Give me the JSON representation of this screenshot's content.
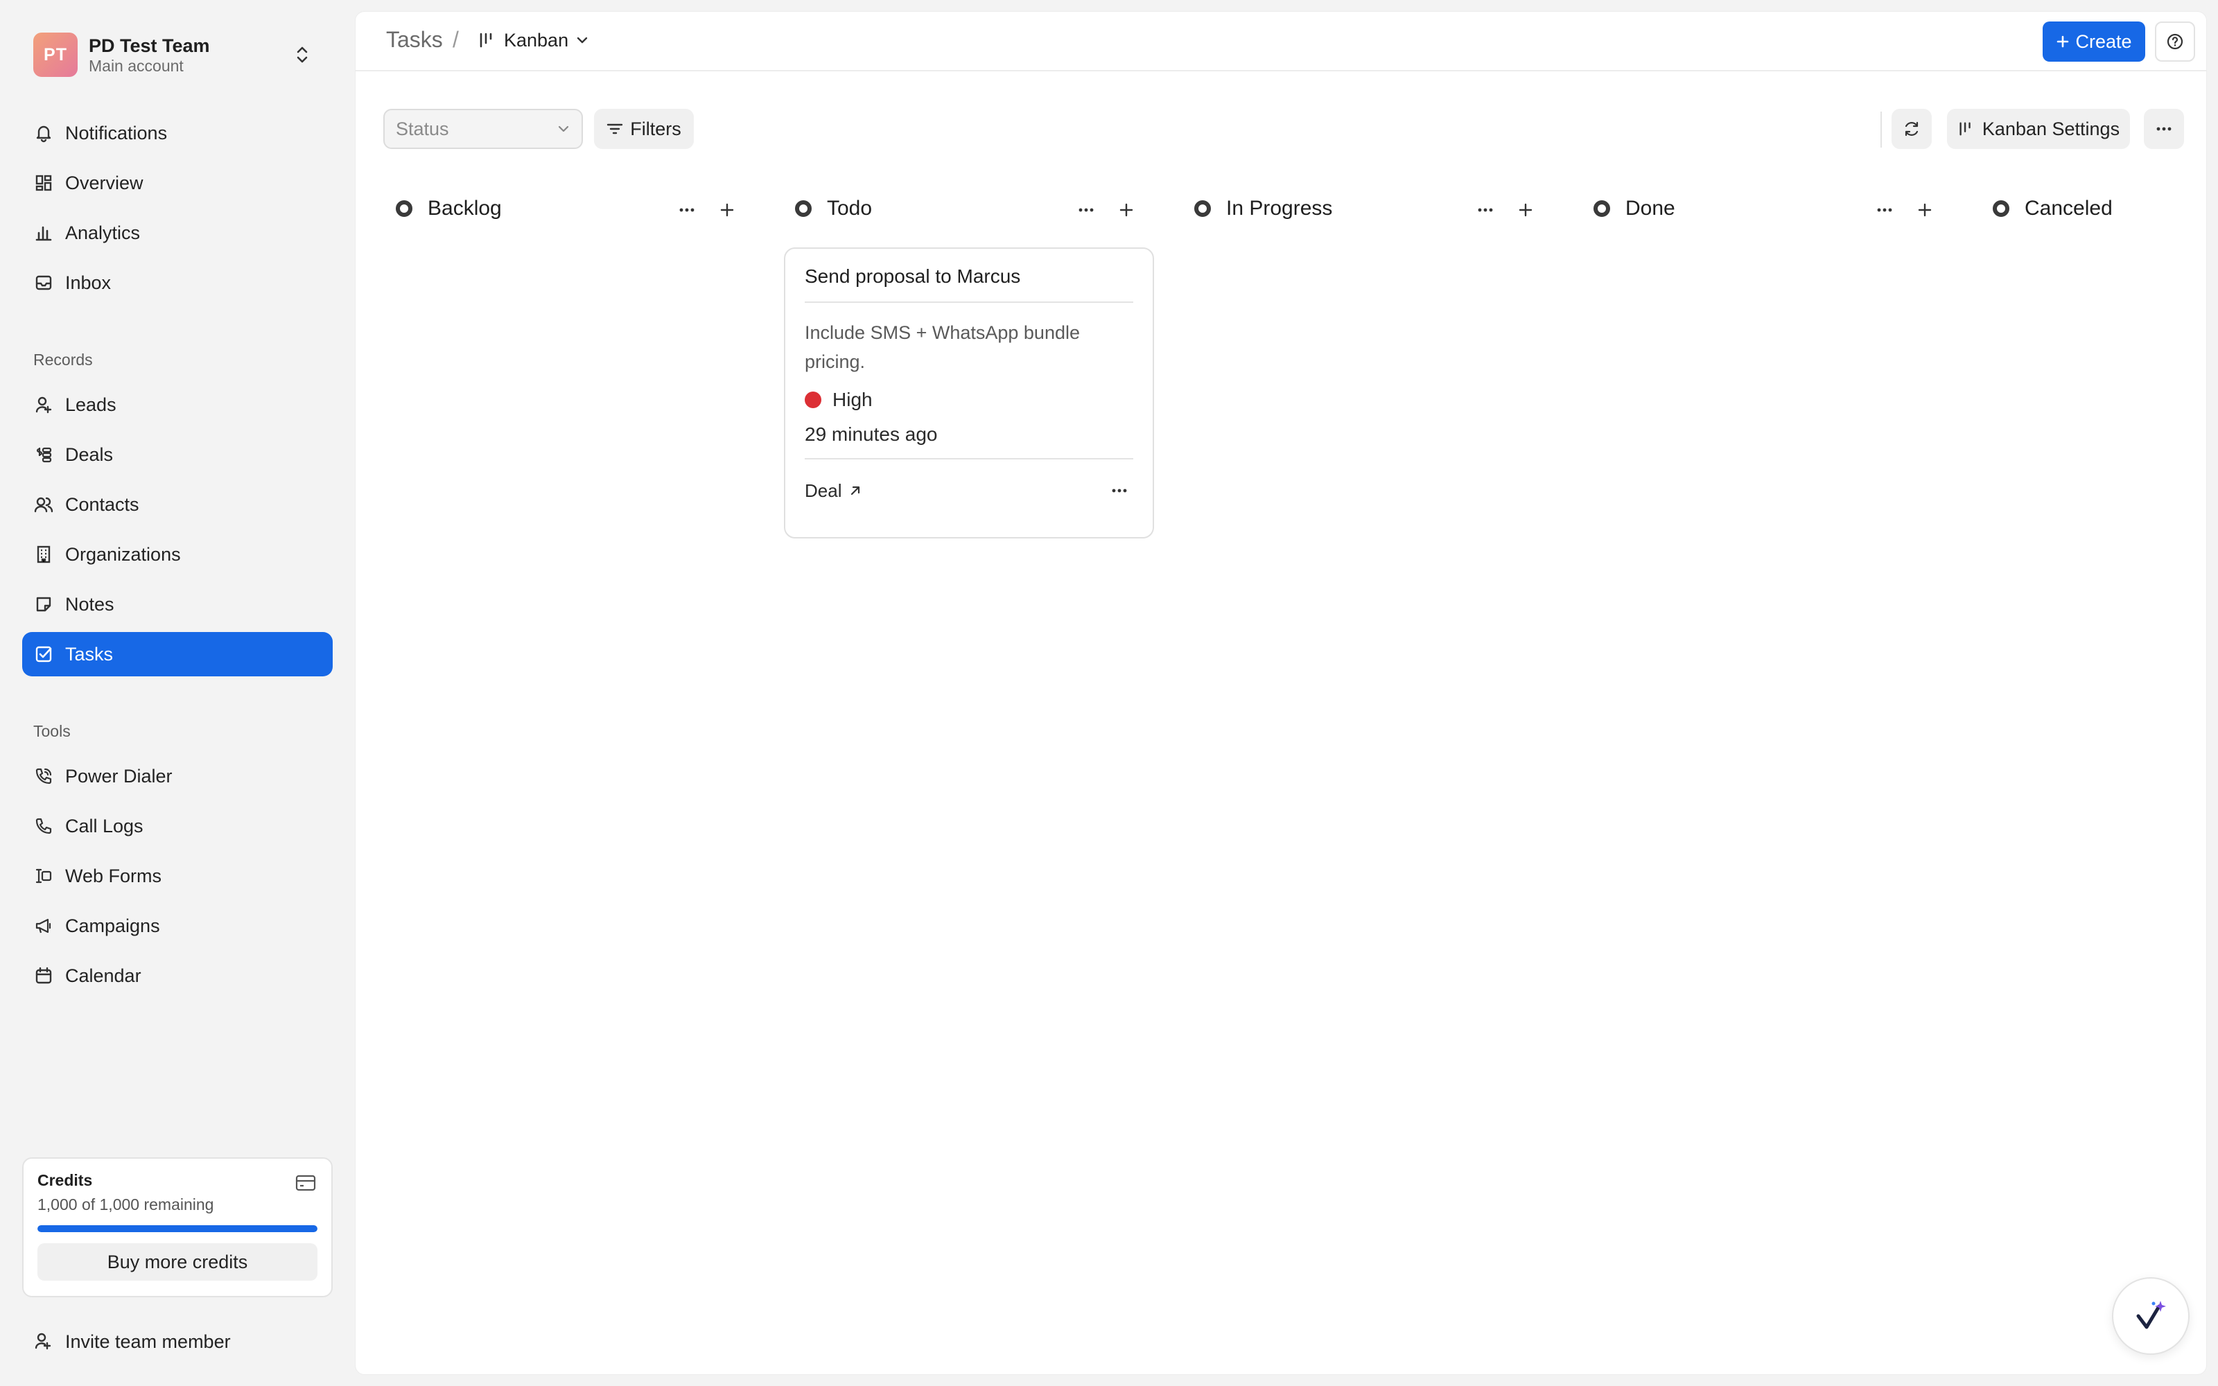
{
  "team": {
    "initials": "PT",
    "name": "PD Test Team",
    "subtitle": "Main account"
  },
  "nav": {
    "main": [
      {
        "label": "Notifications",
        "icon": "bell-icon"
      },
      {
        "label": "Overview",
        "icon": "dashboard-icon"
      },
      {
        "label": "Analytics",
        "icon": "bar-chart-icon"
      },
      {
        "label": "Inbox",
        "icon": "inbox-icon"
      }
    ],
    "records_title": "Records",
    "records": [
      {
        "label": "Leads",
        "icon": "user-plus-icon"
      },
      {
        "label": "Deals",
        "icon": "dollar-stack-icon"
      },
      {
        "label": "Contacts",
        "icon": "users-icon"
      },
      {
        "label": "Organizations",
        "icon": "building-icon"
      },
      {
        "label": "Notes",
        "icon": "note-icon"
      },
      {
        "label": "Tasks",
        "icon": "checkbox-icon",
        "active": true
      }
    ],
    "tools_title": "Tools",
    "tools": [
      {
        "label": "Power Dialer",
        "icon": "phone-signal-icon"
      },
      {
        "label": "Call Logs",
        "icon": "phone-icon"
      },
      {
        "label": "Web Forms",
        "icon": "form-icon"
      },
      {
        "label": "Campaigns",
        "icon": "megaphone-icon"
      },
      {
        "label": "Calendar",
        "icon": "calendar-icon"
      }
    ]
  },
  "credits": {
    "title": "Credits",
    "remaining_text": "1,000 of 1,000 remaining",
    "progress_fraction": 1.0,
    "buy_label": "Buy more credits"
  },
  "invite_label": "Invite team member",
  "header": {
    "breadcrumb_root": "Tasks",
    "breadcrumb_sep": "/",
    "view_label": "Kanban",
    "create_label": "Create"
  },
  "toolbar": {
    "status_placeholder": "Status",
    "filters_label": "Filters",
    "kanban_settings_label": "Kanban Settings"
  },
  "columns": [
    {
      "title": "Backlog"
    },
    {
      "title": "Todo"
    },
    {
      "title": "In Progress"
    },
    {
      "title": "Done"
    },
    {
      "title": "Canceled"
    }
  ],
  "card": {
    "title": "Send proposal to Marcus",
    "description": "Include SMS + WhatsApp bundle pricing.",
    "priority": "High",
    "priority_color": "#dc2f35",
    "time": "29 minutes ago",
    "link_label": "Deal"
  },
  "colors": {
    "accent": "#1768e6",
    "sidebar_bg": "#f3f3f3",
    "panel_bg": "#ffffff"
  }
}
